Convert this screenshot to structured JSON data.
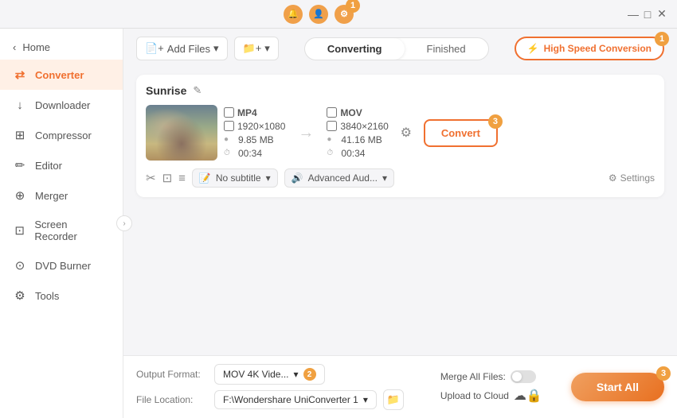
{
  "titlebar": {
    "notification_badge": "1",
    "min_label": "—",
    "max_label": "□",
    "close_label": "✕"
  },
  "sidebar": {
    "home_label": "Home",
    "items": [
      {
        "id": "converter",
        "label": "Converter",
        "icon": "⇄",
        "active": true
      },
      {
        "id": "downloader",
        "label": "Downloader",
        "icon": "↓"
      },
      {
        "id": "compressor",
        "label": "Compressor",
        "icon": "⊞"
      },
      {
        "id": "editor",
        "label": "Editor",
        "icon": "✏"
      },
      {
        "id": "merger",
        "label": "Merger",
        "icon": "⊕"
      },
      {
        "id": "screen-recorder",
        "label": "Screen Recorder",
        "icon": "⊡"
      },
      {
        "id": "dvd-burner",
        "label": "DVD Burner",
        "icon": "⊙"
      },
      {
        "id": "tools",
        "label": "Tools",
        "icon": "⚙"
      }
    ]
  },
  "toolbar": {
    "add_file_label": "Add Files",
    "add_folder_label": "Add Folder",
    "tabs": [
      {
        "id": "converting",
        "label": "Converting",
        "active": true
      },
      {
        "id": "finished",
        "label": "Finished"
      }
    ],
    "high_speed_label": "High Speed Conversion",
    "badge": "1"
  },
  "file_card": {
    "title": "Sunrise",
    "source": {
      "format": "MP4",
      "resolution": "1920×1080",
      "size": "9.85 MB",
      "duration": "00:34"
    },
    "target": {
      "format": "MOV",
      "resolution": "3840×2160",
      "size": "41.16 MB",
      "duration": "00:34"
    },
    "convert_btn_label": "Convert",
    "subtitle_label": "No subtitle",
    "audio_label": "Advanced Aud...",
    "settings_label": "Settings",
    "badge": "3"
  },
  "bottom_bar": {
    "output_format_label": "Output Format:",
    "output_format_value": "MOV 4K Vide...",
    "file_location_label": "File Location:",
    "file_location_value": "F:\\Wondershare UniConverter 1",
    "merge_label": "Merge All Files:",
    "upload_label": "Upload to Cloud",
    "start_all_label": "Start All",
    "badge": "2",
    "start_badge": "3"
  }
}
